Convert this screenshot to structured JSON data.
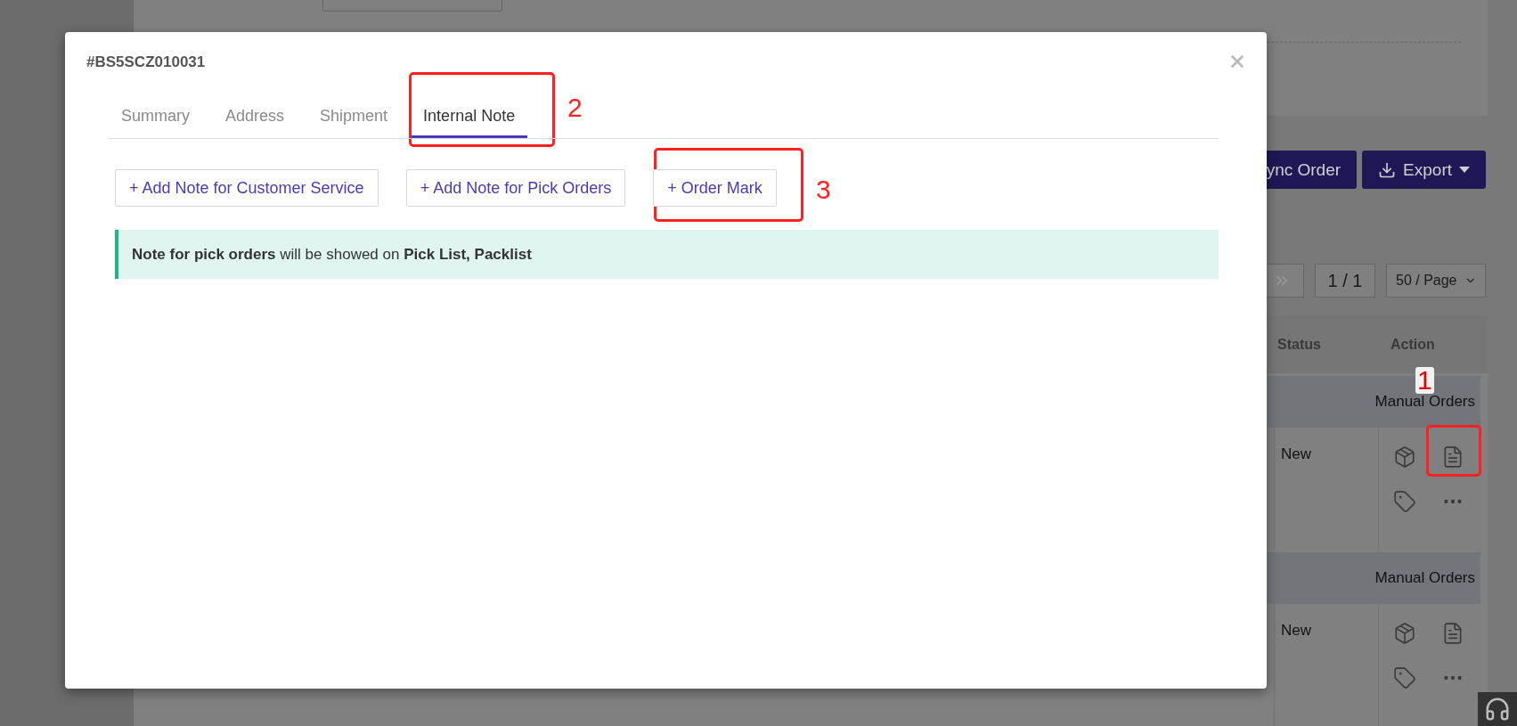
{
  "background": {
    "toolbar": [
      {
        "label": "ync Order",
        "kind": "plain"
      },
      {
        "label": "Export",
        "kind": "dropdown"
      }
    ],
    "pagination": {
      "page": "1 / 1",
      "page_size": "50 / Page"
    },
    "table": {
      "columns": [
        "Status",
        "Action"
      ],
      "groups": [
        {
          "source": "Manual Orders",
          "status": "New"
        },
        {
          "source": "Manual Orders",
          "status": "New"
        }
      ]
    }
  },
  "modal": {
    "title": "#BS5SCZ010031",
    "tabs": [
      {
        "label": "Summary",
        "selected": false
      },
      {
        "label": "Address",
        "selected": false
      },
      {
        "label": "Shipment",
        "selected": false
      },
      {
        "label": "Internal Note",
        "selected": true
      }
    ],
    "buttons": [
      "+ Add Note for Customer Service",
      "+ Add Note for Pick Orders",
      "+ Order Mark"
    ],
    "info": "**Note for pick orders** will be showed on **Pick List, Packlist**"
  },
  "annotations": [
    {
      "label": "1"
    },
    {
      "label": "2"
    },
    {
      "label": "3"
    }
  ]
}
